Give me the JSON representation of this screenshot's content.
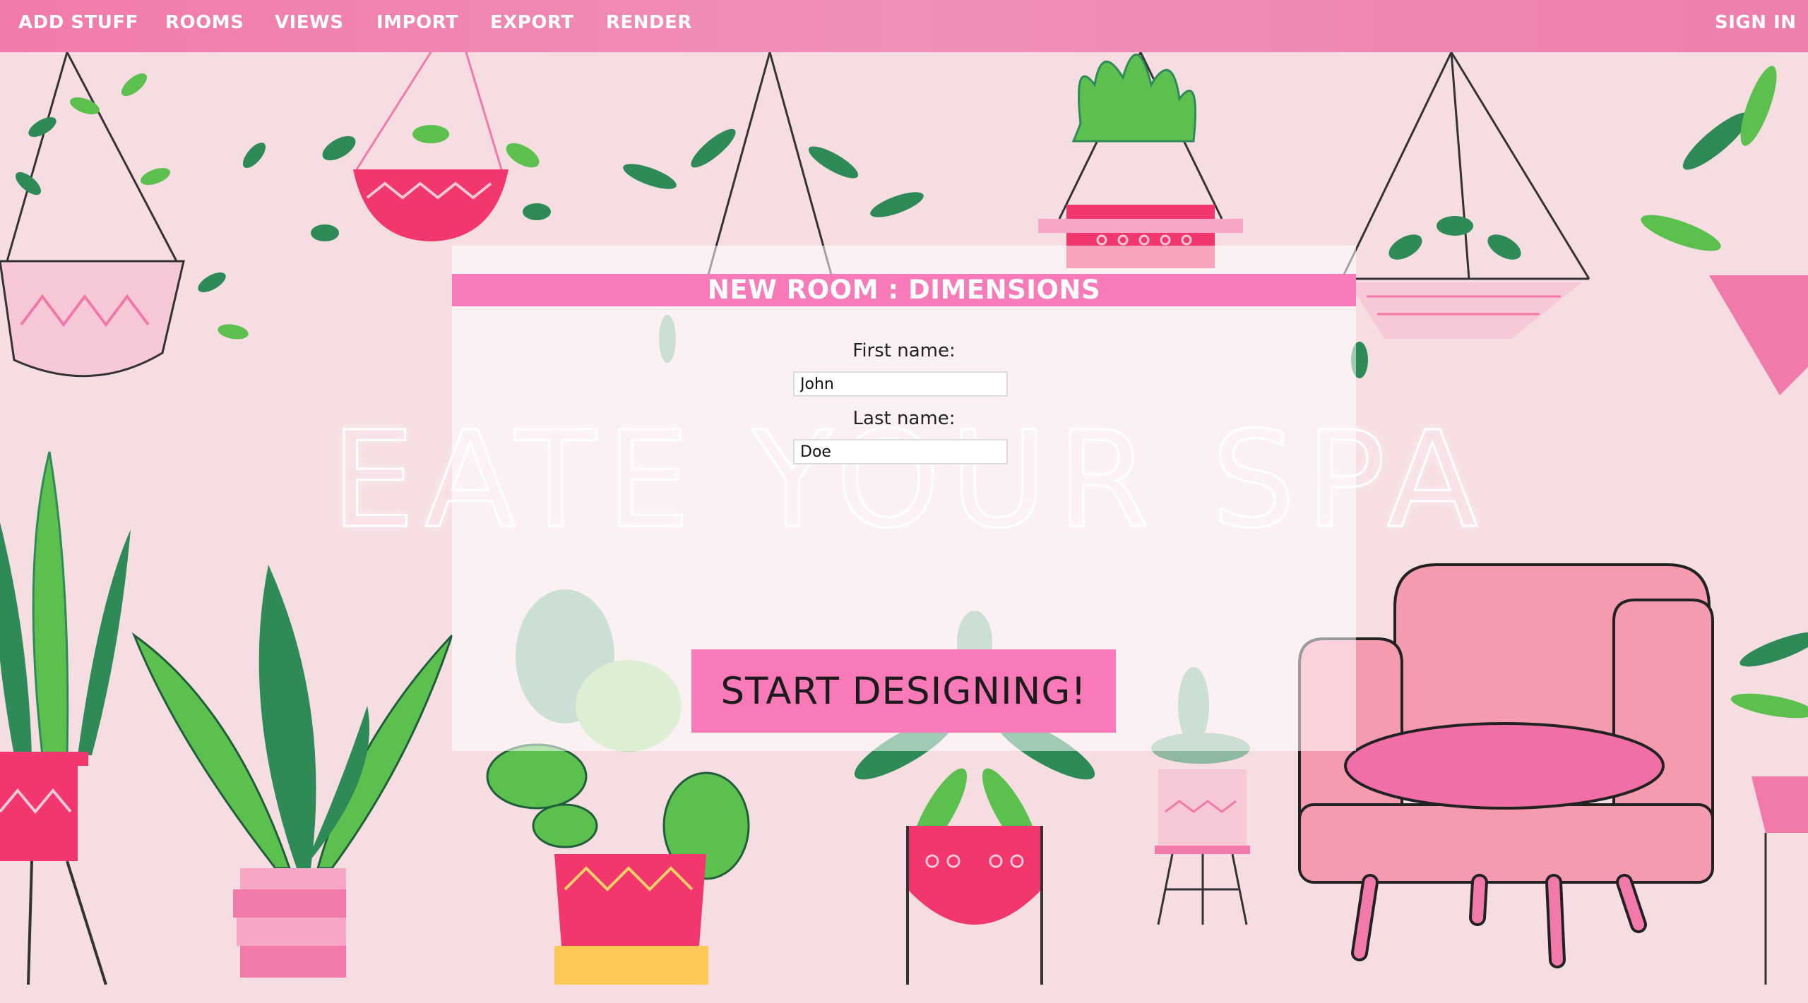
{
  "nav": {
    "items": [
      "ADD STUFF",
      "ROOMS",
      "VIEWS",
      "IMPORT",
      "EXPORT",
      "RENDER"
    ],
    "sign_in": "SIGN IN"
  },
  "hero": {
    "headline": "CREATE YOUR SPACE"
  },
  "dialog": {
    "title": "NEW ROOM : DIMENSIONS",
    "first_name_label": "First name:",
    "first_name_value": "John",
    "last_name_label": "Last name:",
    "last_name_value": "Doe",
    "submit_label": "START DESIGNING!"
  },
  "colors": {
    "nav": "#f27aaa",
    "accent": "#f87ab8",
    "background": "#f6dde2",
    "leaf_dark": "#2e8b57",
    "leaf_light": "#5cc04f",
    "pot_pink": "#f2366e",
    "chair_pink": "#f59bb0"
  },
  "icons": [
    "hanging-plant-icon",
    "potted-plant-icon",
    "armchair-icon"
  ]
}
